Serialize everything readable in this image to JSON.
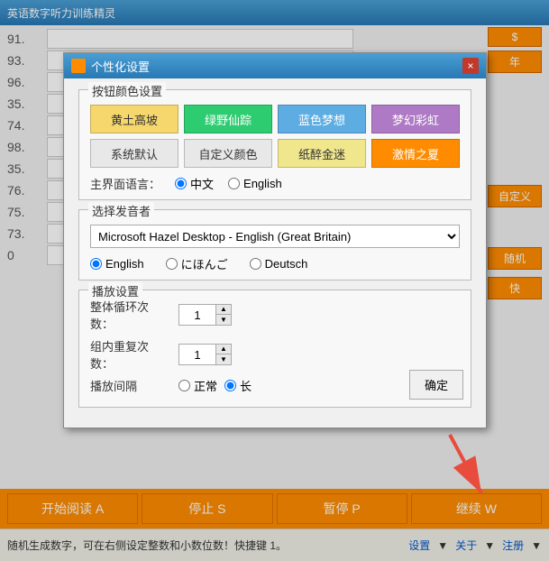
{
  "app": {
    "title": "英语数字听力训练精灵",
    "close_label": "×"
  },
  "main": {
    "rows": [
      {
        "label": "91.",
        "value": ""
      },
      {
        "label": "93.",
        "value": ""
      },
      {
        "label": "96.",
        "value": ""
      },
      {
        "label": "35.",
        "value": ""
      },
      {
        "label": "74.",
        "value": ""
      },
      {
        "label": "98.",
        "value": ""
      },
      {
        "label": "35.",
        "value": ""
      },
      {
        "label": "76.",
        "value": ""
      },
      {
        "label": "75.",
        "value": ""
      },
      {
        "label": "73.",
        "value": ""
      }
    ],
    "right_buttons": [
      "$",
      "年",
      "自定义"
    ],
    "random_label": "随机"
  },
  "toolbar": {
    "start_label": "开始阅读 A",
    "stop_label": "停止 S",
    "pause_label": "暂停 P",
    "continue_label": "继续 W"
  },
  "statusbar": {
    "hint": "随机生成数字，可在右侧设定整数和小数位数！快捷键 1。",
    "settings": "设置",
    "about": "关于",
    "register": "注册"
  },
  "dialog": {
    "title": "个性化设置",
    "icon": "gear",
    "close_label": "×",
    "sections": {
      "button_color": {
        "title": "按钮颜色设置",
        "colors_row1": [
          {
            "label": "黄土高坡",
            "bg": "#f5d76e",
            "text": "#333"
          },
          {
            "label": "绿野仙踪",
            "bg": "#2ecc71",
            "text": "#fff"
          },
          {
            "label": "蓝色梦想",
            "bg": "#5dade2",
            "text": "#fff"
          },
          {
            "label": "梦幻彩虹",
            "bg": "#af7ac5",
            "text": "#fff"
          }
        ],
        "colors_row2": [
          {
            "label": "系统默认",
            "bg": "#e8e8e8",
            "text": "#333"
          },
          {
            "label": "自定义颜色",
            "bg": "#e8e8e8",
            "text": "#333"
          },
          {
            "label": "纸醉金迷",
            "bg": "#f0e68c",
            "text": "#333"
          },
          {
            "label": "激情之夏",
            "bg": "#ff8c00",
            "text": "#fff"
          }
        ],
        "lang_label": "主界面语言：",
        "lang_options": [
          {
            "label": "中文",
            "value": "zh",
            "selected": true
          },
          {
            "label": "English",
            "value": "en",
            "selected": false
          }
        ]
      },
      "speaker": {
        "title": "选择发音者",
        "dropdown_value": "Microsoft Hazel Desktop - English (Great Britain)",
        "dropdown_options": [
          "Microsoft Hazel Desktop - English (Great Britain)"
        ],
        "lang_options": [
          {
            "label": "English",
            "value": "en",
            "selected": true
          },
          {
            "label": "にほんご",
            "value": "ja",
            "selected": false
          },
          {
            "label": "Deutsch",
            "value": "de",
            "selected": false
          }
        ]
      },
      "playback": {
        "title": "播放设置",
        "loop_label": "整体循环次数：",
        "loop_value": "1",
        "repeat_label": "组内重复次数：",
        "repeat_value": "1",
        "interval_label": "播放间隔",
        "interval_options": [
          {
            "label": "正常",
            "value": "normal",
            "selected": false
          },
          {
            "label": "长",
            "value": "long",
            "selected": true
          }
        ]
      }
    },
    "confirm_label": "确定"
  },
  "arrow": {
    "color": "#e74c3c"
  }
}
